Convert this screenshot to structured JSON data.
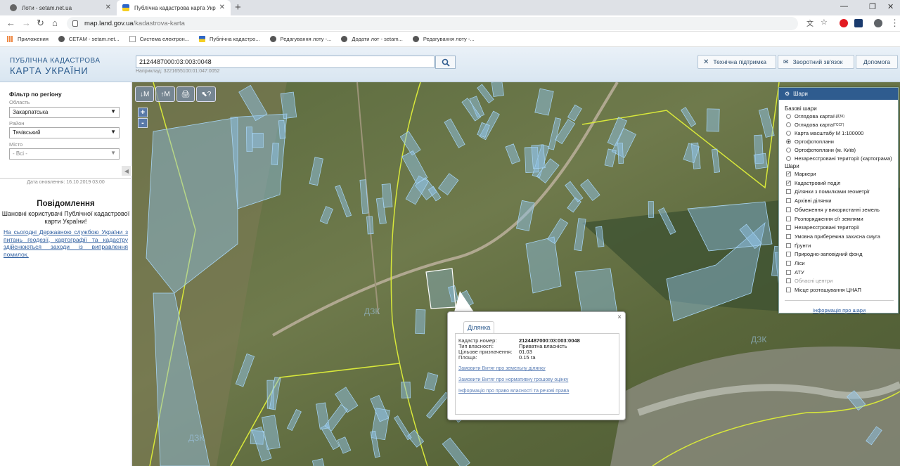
{
  "browser": {
    "tabs": [
      {
        "title": "Лоти - setam.net.ua",
        "active": false
      },
      {
        "title": "Публічна кадастрова карта Укр",
        "active": true
      }
    ],
    "url_host": "map.land.gov.ua",
    "url_path": "/kadastrova-karta",
    "bookmarks": [
      "Приложения",
      "СЕТАМ - setam.net...",
      "Система електрон...",
      "Публічна кадастро...",
      "Редагування лоту -...",
      "Додати лот - setam...",
      "Редагування лоту -..."
    ]
  },
  "header": {
    "logo_line1": "ПУБЛІЧНА КАДАСТРОВА",
    "logo_line2": "КАРТА УКРАЇНИ",
    "search_value": "2124487000:03:003:0048",
    "search_hint": "Наприклад: 3221655100:01:047:0052",
    "tech_support": "Технічна підтримка",
    "feedback": "Зворотний зв'язок",
    "help": "Допомога"
  },
  "sidebar": {
    "filter_title": "Фільтр по регіону",
    "oblast_label": "Область",
    "oblast_value": "Закарпатська",
    "raion_label": "Район",
    "raion_value": "Тячівський",
    "misto_label": "Місто",
    "misto_value": "- Всі -",
    "update_text": "Дата оновлення: 16.10.2019 03:00",
    "msg_title": "Повідомлення",
    "msg_body": "Шановні користувачі Публічної кадастрової карти України!",
    "msg_link": "На сьогодні Державною службою України з питань геодезії, картографії та кадастру здійснюються заходи із виправлення помилок."
  },
  "map": {
    "tools": [
      "↓M",
      "↑M",
      "🖨",
      "⬉?"
    ],
    "zoom_in": "+",
    "zoom_out": "-"
  },
  "layers": {
    "title": "Шари",
    "base_title": "Базові шари",
    "base": [
      {
        "label": "Оглядова карта",
        "sup": "(ЦДЗК)",
        "on": false
      },
      {
        "label": "Оглядова карта",
        "sup": "(ГССГ)",
        "on": false
      },
      {
        "label": "Карта масштабу М 1:100000",
        "sup": "",
        "on": false
      },
      {
        "label": "Ортофотоплани",
        "sup": "",
        "on": true
      },
      {
        "label": "Ортофотоплани (м. Київ)",
        "sup": "",
        "on": false
      },
      {
        "label": "Незареєстровані території (картограма)",
        "sup": "",
        "on": false
      }
    ],
    "overlay_title": "Шари",
    "overlays": [
      {
        "label": "Маркери",
        "on": true
      },
      {
        "label": "Кадастровий поділ",
        "on": true
      },
      {
        "label": "Ділянки з помилками геометрії",
        "on": false
      },
      {
        "label": "Архівні ділянки",
        "on": false
      },
      {
        "label": "Обмеження у використанні земель",
        "on": false
      },
      {
        "label": "Розпорядження с/г землями",
        "on": false
      },
      {
        "label": "Незареєстровані території",
        "on": false
      },
      {
        "label": "Умовна прибережна захисна смуга",
        "on": false
      },
      {
        "label": "Ґрунти",
        "on": false
      },
      {
        "label": "Природно-заповідний фонд",
        "on": false
      },
      {
        "label": "Ліси",
        "on": false
      },
      {
        "label": "АТУ",
        "on": false
      },
      {
        "label": "Обласні центри",
        "on": false,
        "dim": true
      },
      {
        "label": "Місце розташування ЦНАП",
        "on": false
      }
    ],
    "info_link": "Інформація про шари"
  },
  "popup": {
    "tab": "Ділянка",
    "rows": [
      {
        "label": "Кадастр.номер:",
        "value": "2124487000:03:003:0048",
        "bold": true
      },
      {
        "label": "Тип власності:",
        "value": "Приватна власність",
        "bold": false
      },
      {
        "label": "Цільове призначення:",
        "value": "01.03",
        "bold": false
      },
      {
        "label": "Площа:",
        "value": "0.15 га",
        "bold": false
      }
    ],
    "links": [
      "Замовити Витяг про земельну ділянку",
      "Замовити Витяг про нормативну грошову оцінку",
      "Інформація про право власності та речові права"
    ],
    "close": "×"
  },
  "colors": {
    "header_text": "#2a5a8c",
    "layers_header": "#2f5c8f",
    "parcel_fill": "#8fc1e6",
    "boundary": "#d8e83a"
  }
}
